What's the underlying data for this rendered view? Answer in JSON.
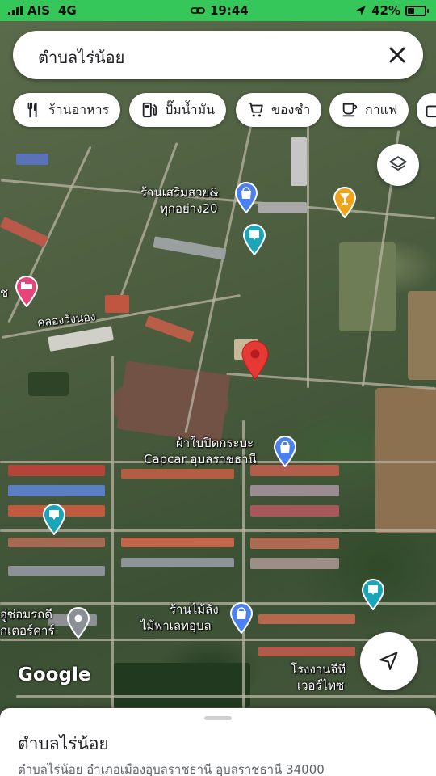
{
  "status_bar": {
    "carrier": "AIS",
    "network": "4G",
    "time": "19:44",
    "battery_percent": "42%",
    "battery_level": 0.42
  },
  "search": {
    "query": "ตำบลไร่น้อย",
    "close_icon": "close-icon"
  },
  "chips": [
    {
      "label": "ร้านอาหาร",
      "icon": "fork-knife-icon"
    },
    {
      "label": "ปั๊มน้ำมัน",
      "icon": "gas-pump-icon"
    },
    {
      "label": "ของชำ",
      "icon": "shopping-cart-icon"
    },
    {
      "label": "กาแฟ",
      "icon": "coffee-cup-icon"
    }
  ],
  "map_labels": {
    "beauty_shop_line1": "ร้านเสริมสวย&",
    "beauty_shop_line2": "ทุกอย่าง20",
    "canal": "คลองวังนอง",
    "cover_shop_line1": "ผ้าใบปิดกระบะ",
    "cover_shop_line2": "Capcar อุบลราชธานี",
    "wood_shop_line1": "ร้านไม้ลัง",
    "wood_shop_line2": "ไม้พาเลทอุบล",
    "repair_line1": "อู่ซ่อมรถดี",
    "repair_line2": "กเตอร์คาร์",
    "factory_line1": "โรงงานจีที",
    "factory_line2": "เวอร์ไทซ",
    "left_edge": "ช"
  },
  "google_logo": "Google",
  "sheet": {
    "title": "ตำบลไร่น้อย",
    "address": "ตำบลไร่น้อย อำเภอเมืองอุบลราชธานี อุบลราชธานี 34000"
  },
  "colors": {
    "status_bar": "#35c759",
    "pin_red": "#e53935",
    "pin_teal": "#1aa5b8",
    "pin_blue": "#4a80f0",
    "pin_orange": "#f0a21a",
    "pin_pink": "#e8447a",
    "pin_gray": "#8a9096"
  }
}
